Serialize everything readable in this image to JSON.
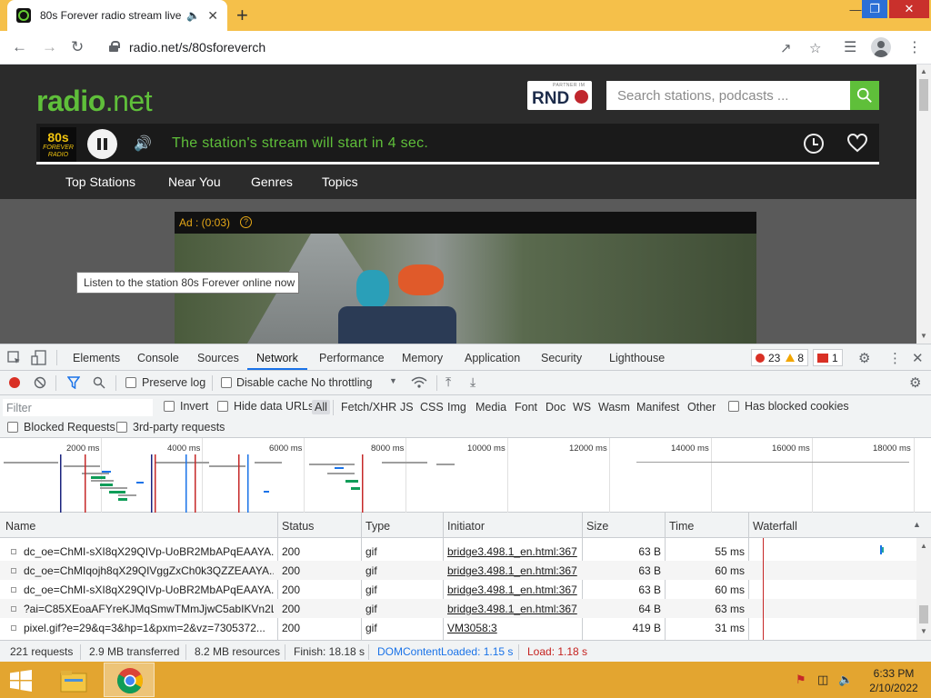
{
  "browser": {
    "tab_title": "80s Forever radio stream live",
    "new_tab": "+",
    "url": "radio.net/s/80sforeverch",
    "window_min": "—",
    "window_max": "❐",
    "window_close": "✕"
  },
  "site": {
    "logo_main": "radio",
    "logo_net": ".net",
    "partner_small": "PARTNER IM",
    "partner_name": "RND",
    "search_placeholder": "Search stations, podcasts ...",
    "player": {
      "station_logo_big": "80s",
      "station_logo_small": "FOREVER RADIO",
      "stream_message": "The station's stream will start in 4 sec."
    },
    "nav": [
      "Top Stations",
      "Near You",
      "Genres",
      "Topics"
    ],
    "ad_label": "Ad : (0:03)",
    "ad_help": "?",
    "tooltip": "Listen to the station 80s Forever online now",
    "accent": "#5fbf3a"
  },
  "devtools": {
    "tabs": [
      "Elements",
      "Console",
      "Sources",
      "Network",
      "Performance",
      "Memory",
      "Application",
      "Security",
      "Lighthouse"
    ],
    "active_tab": "Network",
    "errors": "23",
    "warnings": "8",
    "issues": "1",
    "toolbar": {
      "preserve_log": "Preserve log",
      "disable_cache": "Disable cache",
      "throttling": "No throttling"
    },
    "filter": {
      "placeholder": "Filter",
      "invert": "Invert",
      "hide_data_urls": "Hide data URLs",
      "types": [
        "All",
        "Fetch/XHR",
        "JS",
        "CSS",
        "Img",
        "Media",
        "Font",
        "Doc",
        "WS",
        "Wasm",
        "Manifest",
        "Other"
      ],
      "active_type": "All",
      "has_blocked_cookies": "Has blocked cookies",
      "blocked_requests": "Blocked Requests",
      "third_party": "3rd-party requests"
    },
    "overview_ticks": [
      "2000 ms",
      "4000 ms",
      "6000 ms",
      "8000 ms",
      "10000 ms",
      "12000 ms",
      "14000 ms",
      "16000 ms",
      "18000 ms"
    ],
    "columns": [
      "Name",
      "Status",
      "Type",
      "Initiator",
      "Size",
      "Time",
      "Waterfall"
    ],
    "rows": [
      {
        "name": "dc_oe=ChMI-sXI8qX29QIVp-UoBR2MbAPqEAAYA...",
        "status": "200",
        "type": "gif",
        "initiator": "bridge3.498.1_en.html:367",
        "size": "63 B",
        "time": "55 ms"
      },
      {
        "name": "dc_oe=ChMIqojh8qX29QIVggZxCh0k3QZZEAAYA...",
        "status": "200",
        "type": "gif",
        "initiator": "bridge3.498.1_en.html:367",
        "size": "63 B",
        "time": "60 ms"
      },
      {
        "name": "dc_oe=ChMI-sXI8qX29QIVp-UoBR2MbAPqEAAYA...",
        "status": "200",
        "type": "gif",
        "initiator": "bridge3.498.1_en.html:367",
        "size": "63 B",
        "time": "60 ms"
      },
      {
        "name": "?ai=C85XEoaAFYreKJMqSmwTMmJjwC5abIKVn2L7...",
        "status": "200",
        "type": "gif",
        "initiator": "bridge3.498.1_en.html:367",
        "size": "64 B",
        "time": "63 ms"
      },
      {
        "name": "pixel.gif?e=29&q=3&hp=1&pxm=2&vz=7305372...",
        "status": "200",
        "type": "gif",
        "initiator": "VM3058:3",
        "size": "419 B",
        "time": "31 ms"
      }
    ],
    "status": {
      "requests": "221 requests",
      "transferred": "2.9 MB transferred",
      "resources": "8.2 MB resources",
      "finish": "Finish: 18.18 s",
      "dom": "DOMContentLoaded: 1.15 s",
      "load": "Load: 1.18 s"
    }
  },
  "taskbar": {
    "time": "6:33 PM",
    "date": "2/10/2022"
  }
}
